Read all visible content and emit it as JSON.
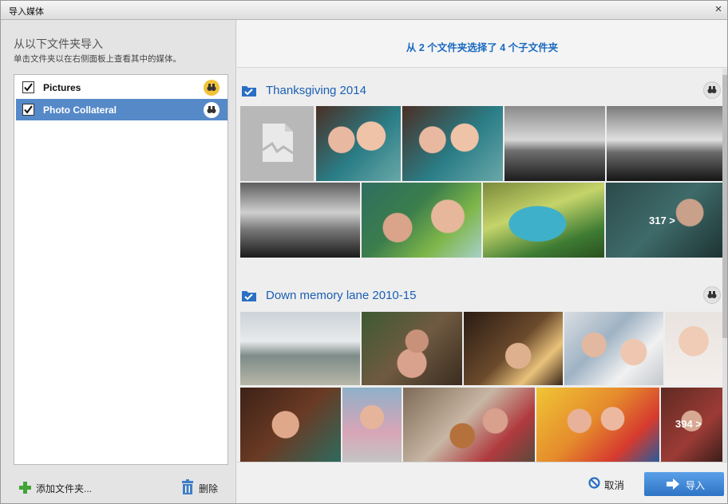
{
  "window": {
    "title": "导入媒体",
    "close_glyph": "×"
  },
  "left_panel": {
    "heading": "从以下文件夹导入",
    "subheading": "单击文件夹以在右侧面板上查看其中的媒体。",
    "folders": [
      {
        "label": "Pictures",
        "checked": true,
        "selected": false
      },
      {
        "label": "Photo Collateral",
        "checked": true,
        "selected": true
      }
    ],
    "add_folder_label": "添加文件夹...",
    "delete_label": "删除"
  },
  "right_panel": {
    "summary": "从 2 个文件夹选择了 4 个子文件夹",
    "groups": [
      {
        "title": "Thanksgiving 2014",
        "more_count": "317 >"
      },
      {
        "title": "Down memory lane 2010-15",
        "more_count": "394 >"
      }
    ],
    "cancel_label": "取消",
    "import_label": "导入"
  },
  "colors": {
    "accent_blue": "#1a5fb4",
    "selection_blue": "#5689c8",
    "binocular_yellow": "#f0c23a",
    "import_button": "#2f74c6"
  },
  "icons": [
    "close-icon",
    "checkbox-checked-icon",
    "binoculars-icon",
    "folder-checked-icon",
    "plus-icon",
    "trash-icon",
    "cancel-icon",
    "import-arrow-icon",
    "broken-image-icon"
  ]
}
